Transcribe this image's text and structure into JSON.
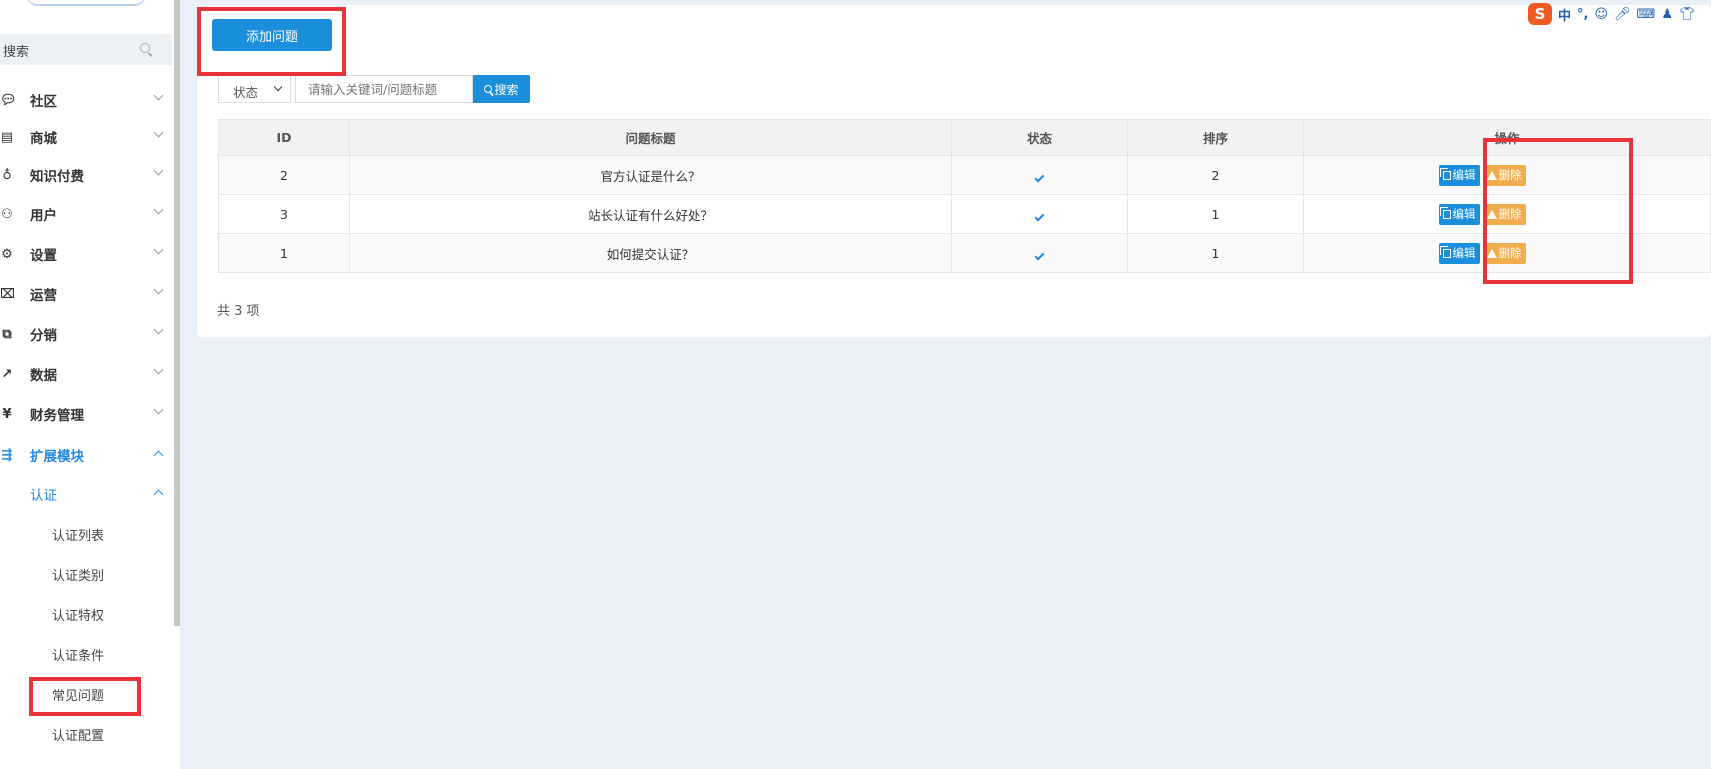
{
  "sidebar": {
    "search_placeholder": "搜索",
    "menu": [
      {
        "label": "社区",
        "icon": "chat-icon"
      },
      {
        "label": "商城",
        "icon": "store-icon"
      },
      {
        "label": "知识付费",
        "icon": "bulb-icon"
      },
      {
        "label": "用户",
        "icon": "users-icon"
      },
      {
        "label": "设置",
        "icon": "gear-icon"
      },
      {
        "label": "运营",
        "icon": "presentation-icon"
      },
      {
        "label": "分销",
        "icon": "sitemap-icon"
      },
      {
        "label": "数据",
        "icon": "chart-line-icon"
      },
      {
        "label": "财务管理",
        "icon": "finance-icon"
      },
      {
        "label": "扩展模块",
        "icon": "extend-icon"
      }
    ],
    "sub": {
      "label": "认证"
    },
    "leaves": [
      "认证列表",
      "认证类别",
      "认证特权",
      "认证条件",
      "常见问题",
      "认证配置"
    ]
  },
  "toolbar": {
    "add_label": "添加问题",
    "status_select": "状态",
    "keyword_placeholder": "请输入关键词/问题标题",
    "search_label": "搜索"
  },
  "table": {
    "headers": [
      "ID",
      "问题标题",
      "状态",
      "排序",
      "操作"
    ],
    "rows": [
      {
        "id": "2",
        "title": "官方认证是什么？",
        "sort": "2",
        "enabled": true
      },
      {
        "id": "3",
        "title": "站长认证有什么好处？",
        "sort": "1",
        "enabled": true
      },
      {
        "id": "1",
        "title": "如何提交认证？",
        "sort": "1",
        "enabled": true
      }
    ],
    "edit_label": "编辑",
    "delete_label": "删除"
  },
  "footer": {
    "total": "共 3 项"
  },
  "ime": {
    "cn": "中",
    "punct": "°,"
  },
  "colors": {
    "accent": "#1b8fdb",
    "warn": "#f0ad4e",
    "highlight": "#e8333a"
  }
}
